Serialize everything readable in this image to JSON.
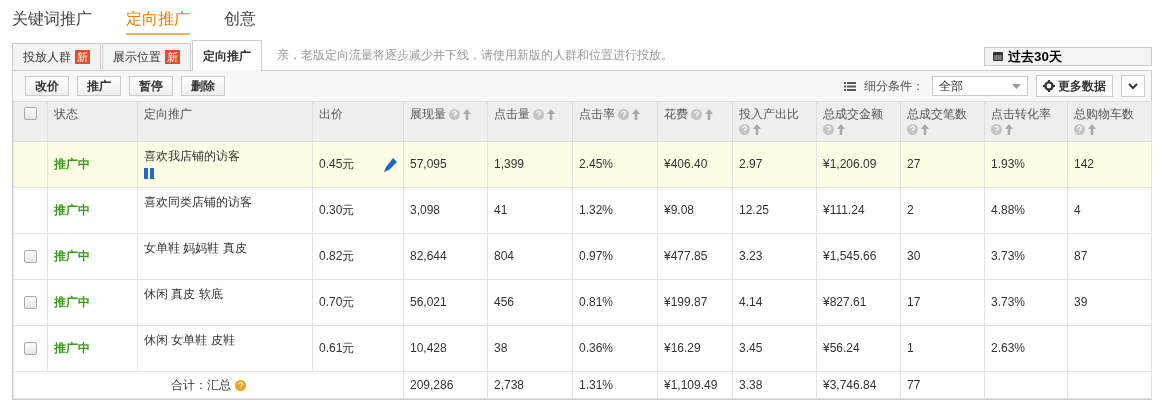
{
  "top_tabs": [
    {
      "label": "关键词推广",
      "selected": false
    },
    {
      "label": "定向推广",
      "selected": true
    },
    {
      "label": "创意",
      "selected": false
    }
  ],
  "sub_tabs": [
    {
      "label": "投放人群",
      "badge": "新",
      "selected": false
    },
    {
      "label": "展示位置",
      "badge": "新",
      "selected": false
    },
    {
      "label": "定向推广",
      "selected": true
    }
  ],
  "notice": "亲，老版定向流量将逐步减少并下线，请使用新版的人群和位置进行投放。",
  "date_range": "过去30天",
  "actions": [
    "改价",
    "推广",
    "暂停",
    "删除"
  ],
  "filter": {
    "label": "细分条件：",
    "value": "全部"
  },
  "more_button": "更多数据",
  "table": {
    "header_checked": false,
    "columns": [
      {
        "label": "状态",
        "kind": "plain"
      },
      {
        "label": "定向推广",
        "kind": "plain"
      },
      {
        "label": "出价",
        "kind": "plain"
      },
      {
        "label": "展现量",
        "kind": "metric"
      },
      {
        "label": "点击量",
        "kind": "metric"
      },
      {
        "label": "点击率",
        "kind": "metric"
      },
      {
        "label": "花费",
        "kind": "metric"
      },
      {
        "label": "投入产出比",
        "kind": "metric"
      },
      {
        "label": "总成交金额",
        "kind": "metric"
      },
      {
        "label": "总成交笔数",
        "kind": "metric"
      },
      {
        "label": "点击转化率",
        "kind": "metric"
      },
      {
        "label": "总购物车数",
        "kind": "metric"
      }
    ],
    "rows": [
      {
        "selected": true,
        "hover": true,
        "cells": [
          "推广中",
          "喜欢我店铺的访客",
          "0.45元",
          "57,095",
          "1,399",
          "2.45%",
          "¥406.40",
          "2.97",
          "¥1,206.09",
          "27",
          "1.93%",
          "142"
        ]
      },
      {
        "selected": false,
        "hover": false,
        "cells": [
          "推广中",
          "喜欢同类店铺的访客",
          "0.30元",
          "3,098",
          "41",
          "1.32%",
          "¥9.08",
          "12.25",
          "¥111.24",
          "2",
          "4.88%",
          "4"
        ]
      },
      {
        "selected": false,
        "hover": false,
        "checked": false,
        "cells": [
          "推广中",
          "女单鞋 妈妈鞋 真皮",
          "0.82元",
          "82,644",
          "804",
          "0.97%",
          "¥477.85",
          "3.23",
          "¥1,545.66",
          "30",
          "3.73%",
          "87"
        ]
      },
      {
        "selected": false,
        "hover": false,
        "checked": false,
        "cells": [
          "推广中",
          "休闲 真皮 软底",
          "0.70元",
          "56,021",
          "456",
          "0.81%",
          "¥199.87",
          "4.14",
          "¥827.61",
          "17",
          "3.73%",
          "39"
        ]
      },
      {
        "selected": false,
        "hover": false,
        "checked": false,
        "cells": [
          "推广中",
          "休闲 女单鞋 皮鞋",
          "0.61元",
          "10,428",
          "38",
          "0.36%",
          "¥16.29",
          "3.45",
          "¥56.24",
          "1",
          "2.63%"
        ]
      }
    ],
    "total": {
      "label": "合计：汇总",
      "cells": [
        "209,286",
        "2,738",
        "1.31%",
        "¥1,109.49",
        "3.38",
        "¥3,746.84",
        "77"
      ]
    }
  }
}
